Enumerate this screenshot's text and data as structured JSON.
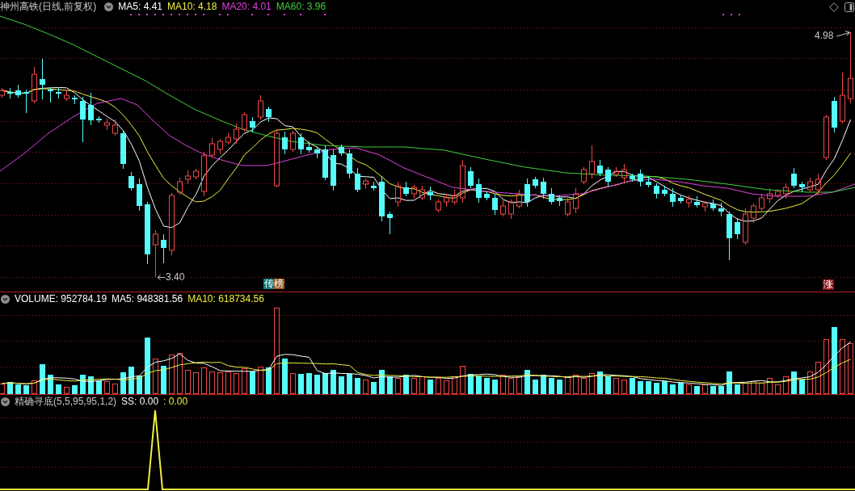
{
  "price_panel": {
    "title": "神州高铁(日线,前复权)",
    "legend": [
      {
        "label": "MA5: 4.41",
        "color": "#ffffff"
      },
      {
        "label": "MA10: 4.18",
        "color": "#f0f040"
      },
      {
        "label": "MA20: 4.01",
        "color": "#e040e0"
      },
      {
        "label": "MA60: 3.96",
        "color": "#40d040"
      }
    ],
    "high_label": "4.98",
    "low_label": "3.40",
    "badges": [
      {
        "text": "传榜",
        "kind": "split"
      },
      {
        "text": "涨",
        "kind": "solid"
      }
    ]
  },
  "volume_panel": {
    "legend": [
      {
        "label": "VOLUME: 952784.19",
        "color": "#ffffff"
      },
      {
        "label": "MA5: 948381.56",
        "color": "#ffffff"
      },
      {
        "label": "MA10: 618734.56",
        "color": "#f0f040"
      }
    ]
  },
  "indicator_panel": {
    "title": "精确寻底(5,5,95,95,1,2)",
    "legend": [
      {
        "label": "SS: 0.00",
        "color": "#ffffff"
      },
      {
        "label": ": 0.00",
        "color": "#f0f040"
      }
    ]
  }
}
